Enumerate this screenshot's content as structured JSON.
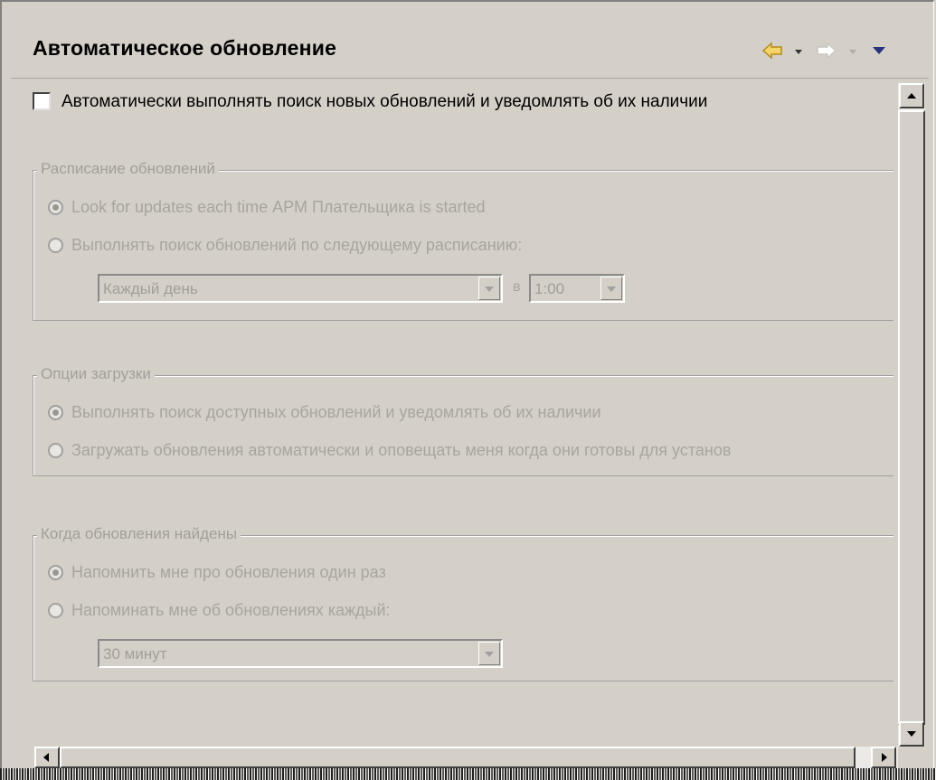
{
  "header": {
    "title": "Автоматическое обновление"
  },
  "auto_check": {
    "label": "Автоматически выполнять поиск новых обновлений и уведомлять об их наличии",
    "checked": false
  },
  "schedule_group": {
    "title": "Расписание обновлений",
    "option_startup": "Look for updates each time АРМ Плательщика is started",
    "option_schedule": "Выполнять поиск обновлений по следующему расписанию:",
    "day_value": "Каждый день",
    "at_label": "в",
    "time_value": "1:00"
  },
  "download_group": {
    "title": "Опции загрузки",
    "option_notify": "Выполнять поиск доступных обновлений и уведомлять об их наличии",
    "option_download": "Загружать обновления автоматически и оповещать меня когда они готовы для установ"
  },
  "found_group": {
    "title": "Когда обновления найдены",
    "option_once": "Напомнить мне про обновления один раз",
    "option_every": "Напоминать мне об обновлениях каждый:",
    "interval_value": "30 минут"
  },
  "colors": {
    "accent_arrow": "#e8c34a",
    "disabled_text": "#a7a59f",
    "face": "#d4d0c8"
  }
}
